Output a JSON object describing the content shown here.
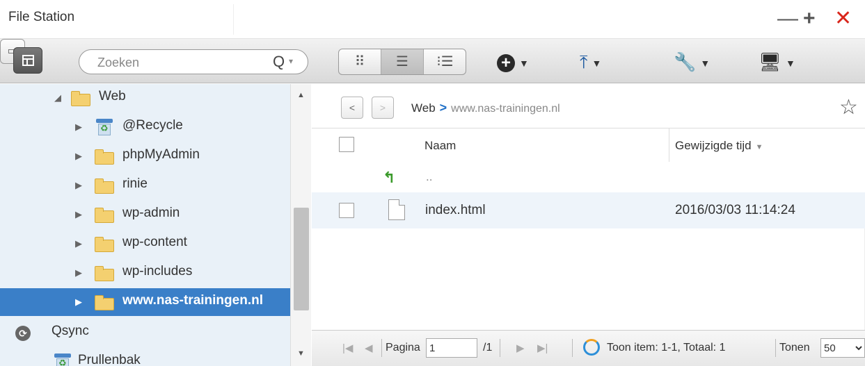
{
  "window": {
    "title": "File Station",
    "minimize": "—",
    "maximize": "+",
    "close": "✕"
  },
  "toolbar": {
    "search_placeholder": "Zoeken",
    "search_icon": "Q",
    "search_dropdown": "▾",
    "view_icons": "⠿",
    "view_list": "☰",
    "view_details": "⁝☰",
    "add_icon": "+",
    "upload_icon": "⤒",
    "tools_icon": "🔧",
    "remote_icon": "🖥",
    "dropdown_caret": "▼"
  },
  "sidebar": {
    "items": [
      {
        "label": "Web",
        "expanded": true,
        "icon": "folder-open-icon"
      },
      {
        "label": "@Recycle",
        "icon": "recycle-bin-icon"
      },
      {
        "label": "phpMyAdmin",
        "icon": "folder-icon"
      },
      {
        "label": "rinie",
        "icon": "folder-icon"
      },
      {
        "label": "wp-admin",
        "icon": "folder-icon"
      },
      {
        "label": "wp-content",
        "icon": "folder-icon"
      },
      {
        "label": "wp-includes",
        "icon": "folder-icon"
      },
      {
        "label": "www.nas-trainingen.nl",
        "icon": "folder-icon",
        "selected": true
      },
      {
        "label": "Qsync",
        "icon": "qsync-icon"
      },
      {
        "label": "Prullenbak",
        "icon": "recycle-bin-icon"
      }
    ]
  },
  "breadcrumb": {
    "back": "<",
    "forward": ">",
    "parent": "Web",
    "separator": ">",
    "current": "www.nas-trainingen.nl"
  },
  "table": {
    "columns": [
      "Naam",
      "Gewijzigde tijd"
    ],
    "sort_indicator": "▼",
    "parent_row": "..",
    "rows": [
      {
        "name": "index.html",
        "modified": "2016/03/03 11:14:24"
      }
    ]
  },
  "pager": {
    "first": "|◀",
    "prev": "◀",
    "page_label": "Pagina",
    "page_value": "1",
    "page_total": "/1",
    "next": "▶",
    "last": "▶|",
    "summary": "Toon item: 1-1, Totaal: 1",
    "show_label": "Tonen",
    "show_value": "50"
  },
  "colors": {
    "selected_bg": "#3a7fc8",
    "sidebar_bg": "#e9f1f8",
    "close_red": "#d9261c",
    "breadcrumb_chevron": "#1e6fc7"
  }
}
